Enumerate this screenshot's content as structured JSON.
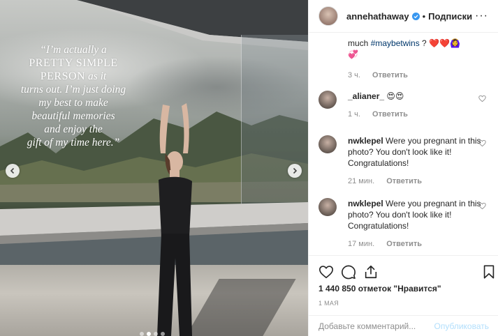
{
  "post": {
    "quote_line1": "“I’m actually a",
    "quote_line2": "PRETTY SIMPLE",
    "quote_line3a": "PERSON",
    "quote_line3b": " as it",
    "quote_line4": "turns out. I’m just doing",
    "quote_line5": "my best to make",
    "quote_line6": "beautiful memories",
    "quote_line7": "and enjoy the",
    "quote_line8": "gift of my time here.”",
    "carousel_count": 4,
    "carousel_active": 2
  },
  "header": {
    "username": "annehathaway",
    "separator": "•",
    "follow_label": "Подписки",
    "more_label": "···"
  },
  "comments": [
    {
      "text_prefix": "much ",
      "hashtag": "#maybetwins",
      "text_suffix": " ?",
      "emoji": "❤️❤️🙆‍♀",
      "emoji2": "💞",
      "time": "3 ч.",
      "reply": "Ответить"
    },
    {
      "username": "_alianer_",
      "text": "😍😍",
      "time": "1 ч.",
      "reply": "Ответить"
    },
    {
      "username": "nwklepel",
      "text": "Were you pregnant in this photo? You don't look like it! Congratulations!",
      "time": "21 мин.",
      "reply": "Ответить"
    },
    {
      "username": "nwklepel",
      "text": "Were you pregnant in this photo? You don't look like it! Congratulations!",
      "time": "17 мин.",
      "reply": "Ответить"
    }
  ],
  "stats": {
    "likes": "1 440 850 отметок \"Нравится\"",
    "date": "1 МАЯ"
  },
  "composer": {
    "placeholder": "Добавьте комментарий...",
    "publish_label": "Опубликовать"
  },
  "colors": {
    "link": "#00376b",
    "verified": "#3897f0",
    "publish_disabled": "#b2dffc",
    "muted": "#8e8e8e"
  }
}
